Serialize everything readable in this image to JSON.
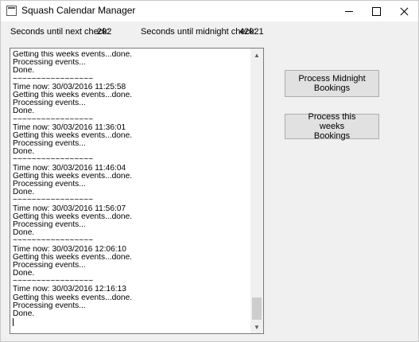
{
  "window": {
    "title": "Squash Calendar Manager",
    "icon": "app-window-icon",
    "controls": [
      "minimize-icon",
      "maximize-icon",
      "close-icon"
    ]
  },
  "status": {
    "next_check_label": "Seconds until next check:",
    "next_check_value": "202",
    "midnight_check_label": "Seconds until midnight check:",
    "midnight_check_value": "42021"
  },
  "log": {
    "lines": [
      "Getting this weeks events...done.",
      "Processing events...",
      "Done.",
      "~~~~~~~~~~~~~~~~~",
      "Time now: 30/03/2016 11:25:58",
      "Getting this weeks events...done.",
      "Processing events...",
      "Done.",
      "~~~~~~~~~~~~~~~~~",
      "Time now: 30/03/2016 11:36:01",
      "Getting this weeks events...done.",
      "Processing events...",
      "Done.",
      "~~~~~~~~~~~~~~~~~",
      "Time now: 30/03/2016 11:46:04",
      "Getting this weeks events...done.",
      "Processing events...",
      "Done.",
      "~~~~~~~~~~~~~~~~~",
      "Time now: 30/03/2016 11:56:07",
      "Getting this weeks events...done.",
      "Processing events...",
      "Done.",
      "~~~~~~~~~~~~~~~~~",
      "Time now: 30/03/2016 12:06:10",
      "Getting this weeks events...done.",
      "Processing events...",
      "Done.",
      "~~~~~~~~~~~~~~~~~",
      "Time now: 30/03/2016 12:16:13",
      "Getting this weeks events...done.",
      "Processing events...",
      "Done."
    ]
  },
  "buttons": {
    "midnight": "Process Midnight Bookings",
    "week": "Process this weeks Bookings"
  }
}
